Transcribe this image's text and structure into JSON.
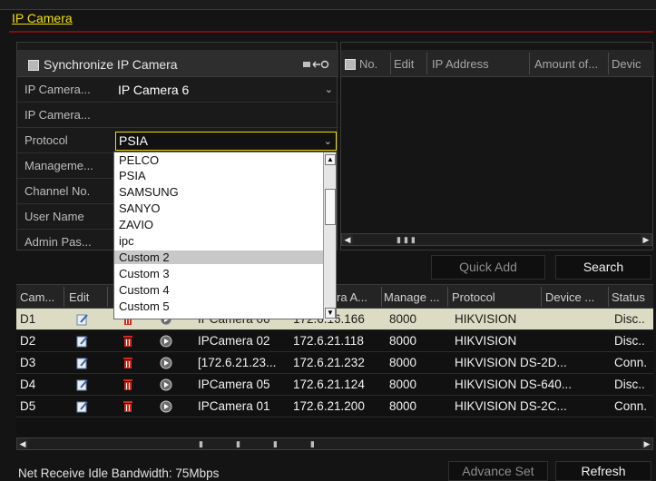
{
  "window": {
    "title": "IP Camera"
  },
  "left_form": {
    "sync_label": "Synchronize IP Camera",
    "rows": [
      {
        "label": "IP Camera...",
        "value": "IP Camera 6",
        "has_select": true
      },
      {
        "label": "IP Camera...",
        "value": ""
      },
      {
        "label": "Protocol",
        "value": "PSIA",
        "has_select": true
      },
      {
        "label": "Manageme...",
        "value": ""
      },
      {
        "label": "Channel No.",
        "value": ""
      },
      {
        "label": "User Name",
        "value": ""
      },
      {
        "label": "Admin Pas...",
        "value": ""
      }
    ],
    "icons": {
      "sync_arrow": "arrow-left-icon",
      "select": "chevron-down-icon"
    }
  },
  "protocol_dropdown": {
    "options": [
      "PELCO",
      "PSIA",
      "SAMSUNG",
      "SANYO",
      "ZAVIO",
      "ipc",
      "Custom 2",
      "Custom 3",
      "Custom 4",
      "Custom 5"
    ],
    "hovered": "Custom 2"
  },
  "right_list": {
    "headers": [
      "No.",
      "Edit",
      "IP Address",
      "Amount of...",
      "Devic"
    ]
  },
  "buttons": {
    "quick_add": "Quick Add",
    "search": "Search",
    "advance_set": "Advance Set",
    "refresh": "Refresh"
  },
  "camera_table": {
    "headers": [
      "Cam...",
      "Edit",
      "",
      "",
      "mera A...",
      "Manage ...",
      "Protocol",
      "Device ...",
      "Status"
    ],
    "rows": [
      {
        "cam": "D1",
        "name": "IPCamera 06",
        "ip": "172.6.16.166",
        "port": "8000",
        "protocol": "HIKVISION",
        "device": "",
        "status": "Disc..",
        "selected": true
      },
      {
        "cam": "D2",
        "name": "IPCamera 02",
        "ip": "172.6.21.118",
        "port": "8000",
        "protocol": "HIKVISION",
        "device": "",
        "status": "Disc..",
        "selected": false
      },
      {
        "cam": "D3",
        "name": "[172.6.21.23...",
        "ip": "172.6.21.232",
        "port": "8000",
        "protocol": "HIKVISION DS-2D...",
        "device": "",
        "status": "Conn.",
        "selected": false
      },
      {
        "cam": "D4",
        "name": "IPCamera 05",
        "ip": "172.6.21.124",
        "port": "8000",
        "protocol": "HIKVISION DS-640...",
        "device": "",
        "status": "Disc..",
        "selected": false
      },
      {
        "cam": "D5",
        "name": "IPCamera 01",
        "ip": "172.6.21.200",
        "port": "8000",
        "protocol": "HIKVISION DS-2C...",
        "device": "",
        "status": "Conn.",
        "selected": false
      }
    ]
  },
  "status": {
    "bandwidth": "Net Receive Idle Bandwidth: 75Mbps"
  },
  "colors": {
    "accent": "#f0e000",
    "delete": "#d42a1c",
    "title_line": "#7b1010",
    "selected_row": "#dcdcc4"
  }
}
